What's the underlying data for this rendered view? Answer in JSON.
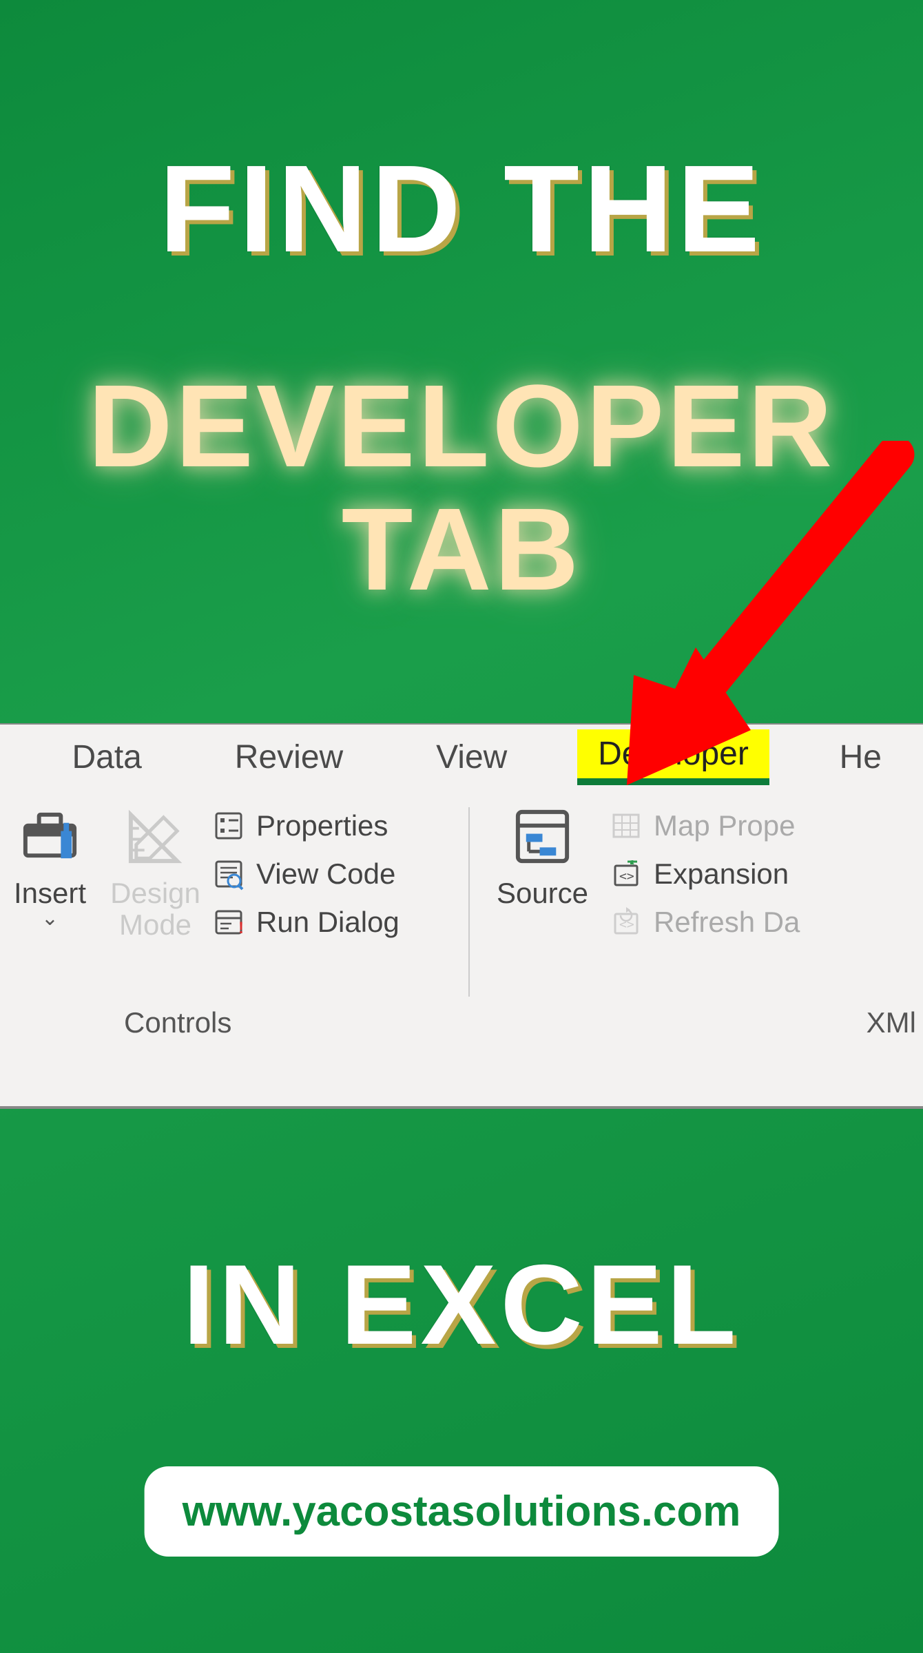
{
  "hero": {
    "line1": "FIND THE",
    "line2": "DEVELOPER TAB",
    "line3": "IN EXCEL"
  },
  "url": "www.yacostasolutions.com",
  "ribbon": {
    "tabs": {
      "data": "Data",
      "review": "Review",
      "view": "View",
      "developer": "Developer",
      "help": "He"
    },
    "controls": {
      "insert": "Insert",
      "design_mode": "Design\nMode",
      "properties": "Properties",
      "view_code": "View Code",
      "run_dialog": "Run Dialog",
      "group_label": "Controls"
    },
    "xml": {
      "source": "Source",
      "map_props": "Map Prope",
      "expansion": "Expansion",
      "refresh": "Refresh Da",
      "group_label": "XMl"
    }
  }
}
